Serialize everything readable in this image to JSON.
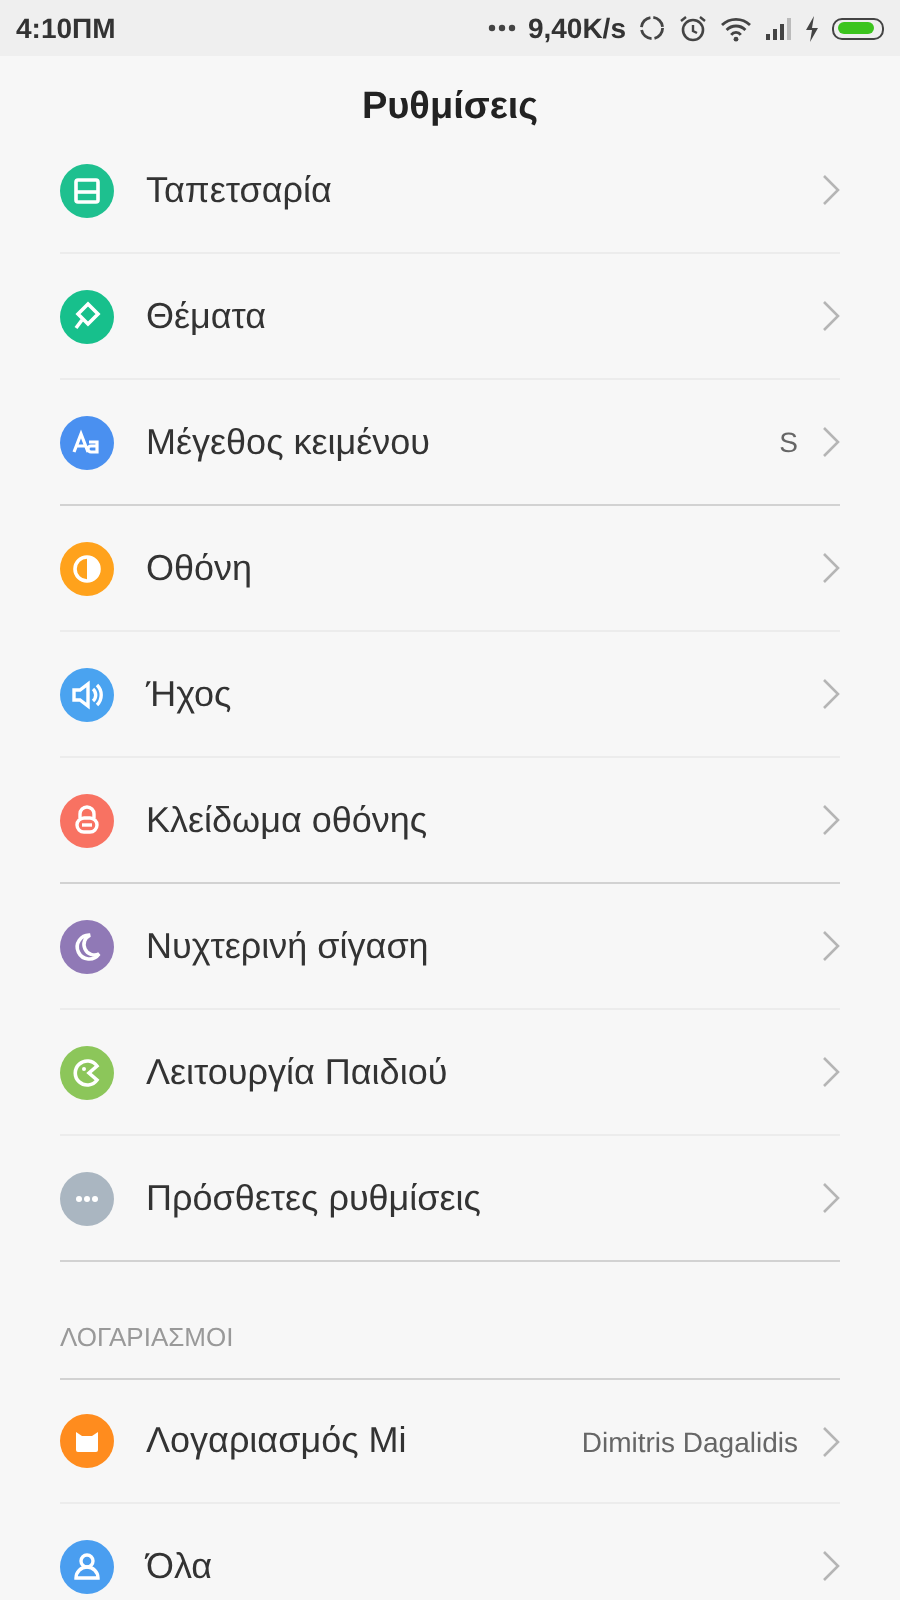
{
  "status_bar": {
    "time": "4:10ΠΜ",
    "network_speed": "9,40K/s"
  },
  "title": "Ρυθμίσεις",
  "groups": [
    {
      "items": [
        {
          "label": "Ταπετσαρία",
          "kind": "wallpaper",
          "color": "#1ec08f"
        },
        {
          "label": "Θέματα",
          "kind": "themes",
          "color": "#17c08c"
        },
        {
          "label": "Μέγεθος κειμένου",
          "kind": "text-size",
          "color": "#4a90f0",
          "value": "S"
        }
      ]
    },
    {
      "items": [
        {
          "label": "Οθόνη",
          "kind": "display",
          "color": "#ffa21c"
        },
        {
          "label": "Ήχος",
          "kind": "sound",
          "color": "#4aa3f0"
        },
        {
          "label": "Κλείδωμα οθόνης",
          "kind": "lock",
          "color": "#f87262"
        }
      ]
    },
    {
      "items": [
        {
          "label": "Νυχτερινή σίγαση",
          "kind": "night",
          "color": "#9079b6"
        },
        {
          "label": "Λειτουργία Παιδιού",
          "kind": "child",
          "color": "#8cc65a"
        },
        {
          "label": "Πρόσθετες ρυθμίσεις",
          "kind": "more",
          "color": "#aab6c1"
        }
      ]
    },
    {
      "header": "ΛΟΓΑΡΙΑΣΜΟΙ",
      "items": [
        {
          "label": "Λογαριασμός Mi",
          "kind": "mi",
          "color": "#ff8c1e",
          "value": "Dimitris Dagalidis"
        },
        {
          "label": "Όλα",
          "kind": "user",
          "color": "#4a9ef0"
        }
      ]
    }
  ]
}
